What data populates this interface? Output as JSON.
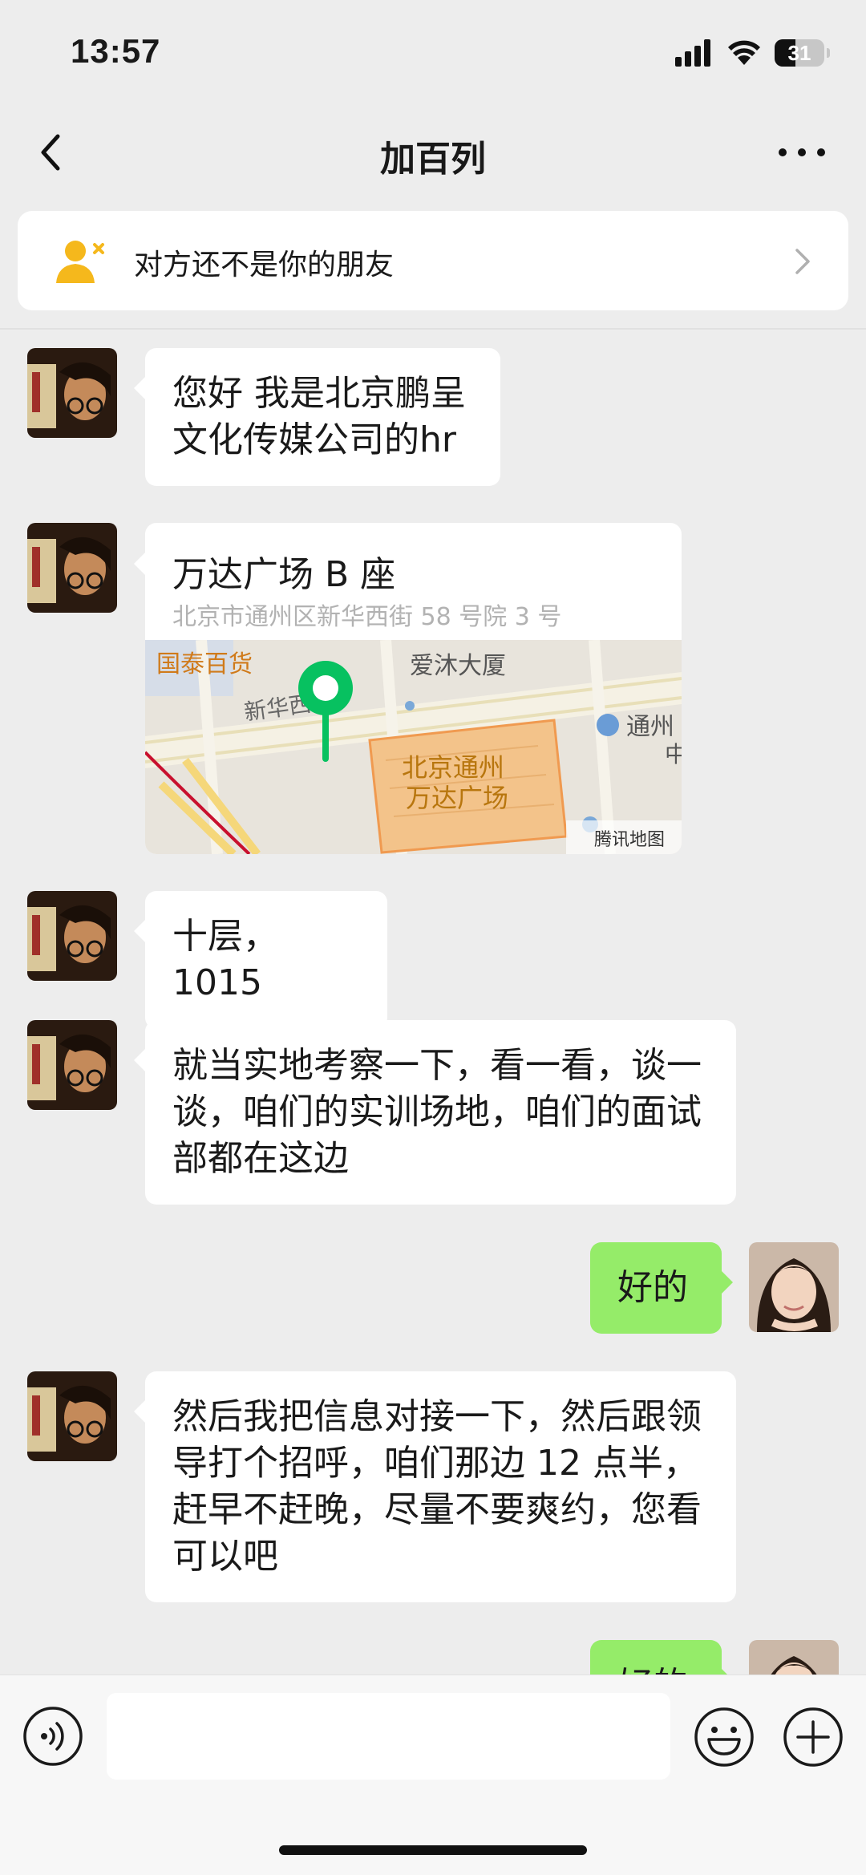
{
  "status_bar": {
    "time": "13:57",
    "battery": "31"
  },
  "nav": {
    "title": "加百列"
  },
  "banner": {
    "text": "对方还不是你的朋友"
  },
  "messages": [
    {
      "from": "other",
      "text": "您好 我是北京鹏呈文化传媒公司的hr"
    },
    {
      "from": "other",
      "type": "location",
      "title": "万达广场 B 座",
      "address": "北京市通州区新华西街 58 号院 3 号",
      "map": {
        "labels": [
          "国泰百货",
          "爱沐大厦",
          "新华西街",
          "通州",
          "北京通州",
          "万达广场",
          "中",
          "腾讯地图"
        ]
      }
    },
    {
      "from": "other",
      "text": "十层，1015"
    },
    {
      "from": "other",
      "text": "就当实地考察一下，看一看，谈一谈，咱们的实训场地，咱们的面试部都在这边"
    },
    {
      "from": "self",
      "text": "好的"
    },
    {
      "from": "other",
      "text": "然后我把信息对接一下，然后跟领导打个招呼，咱们那边 12 点半，赶早不赶晚，尽量不要爽约，您看可以吧"
    },
    {
      "from": "self",
      "text": "好的"
    }
  ],
  "input": {
    "value": ""
  },
  "colors": {
    "background": "#ededed",
    "self_bubble": "#95ec69",
    "pin": "#07c160",
    "banner_icon": "#f5b81c"
  }
}
